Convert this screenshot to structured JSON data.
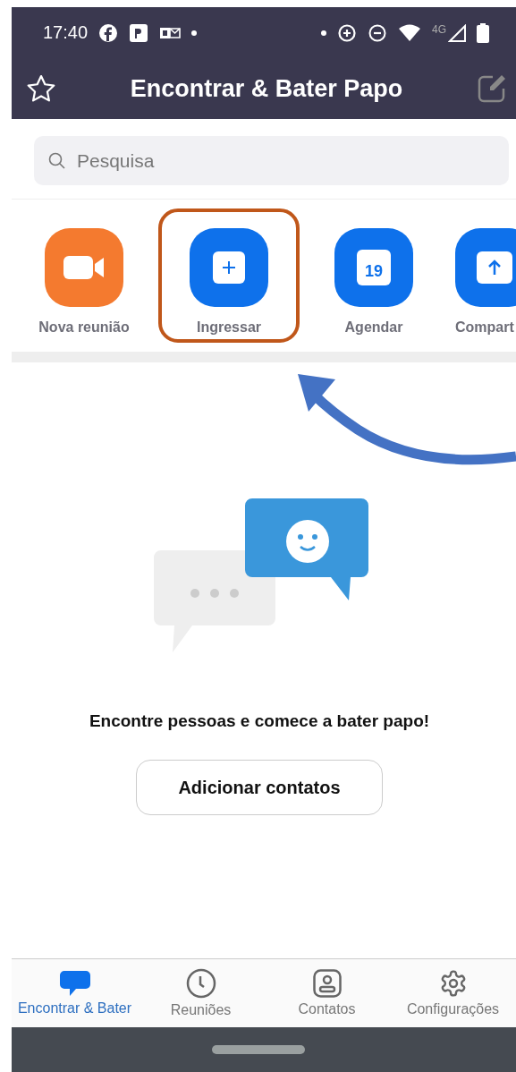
{
  "status_bar": {
    "time": "17:40",
    "network": "4G"
  },
  "header": {
    "title": "Encontrar & Bater Papo"
  },
  "search": {
    "placeholder": "Pesquisa"
  },
  "actions": [
    {
      "label": "Nova reunião",
      "kind": "video",
      "highlighted": false
    },
    {
      "label": "Ingressar",
      "kind": "join",
      "highlighted": true
    },
    {
      "label": "Agendar",
      "kind": "calendar",
      "highlighted": false,
      "day": "19"
    },
    {
      "label": "Compart",
      "kind": "share",
      "highlighted": false
    }
  ],
  "empty_state": {
    "message": "Encontre pessoas e comece a bater papo!",
    "button": "Adicionar contatos"
  },
  "nav": [
    {
      "label": "Encontrar & Bater",
      "kind": "chat",
      "selected": true
    },
    {
      "label": "Reuniões",
      "kind": "clock",
      "selected": false
    },
    {
      "label": "Contatos",
      "kind": "contact",
      "selected": false
    },
    {
      "label": "Configurações",
      "kind": "gear",
      "selected": false
    }
  ]
}
